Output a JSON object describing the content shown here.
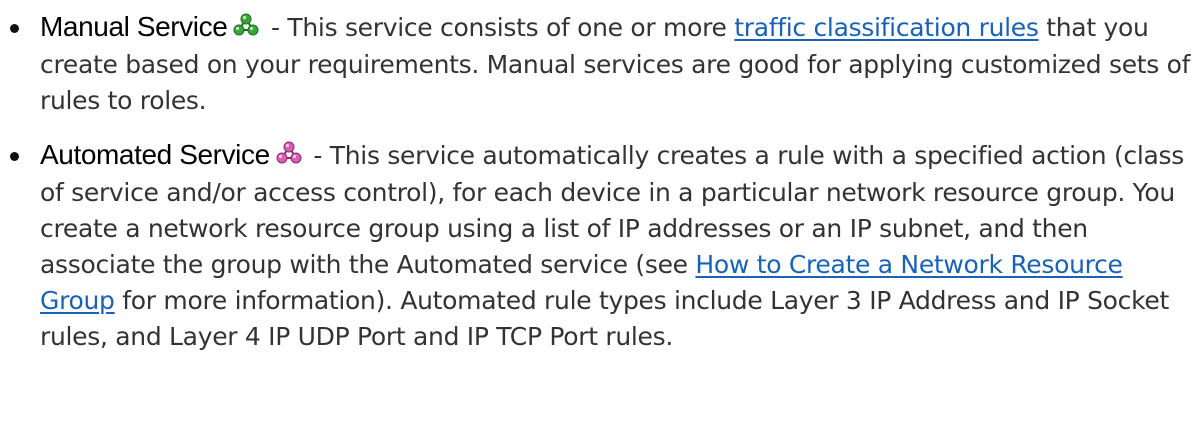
{
  "services": [
    {
      "term": "Manual Service",
      "icon": "manual-service-icon",
      "icon_color": "#2e8b2e",
      "text_before_link": " - This service consists of one or more ",
      "link_text": "traffic classification rules",
      "text_after_link": " that you create based on your requirements. Manual services are good for applying customized sets of rules to roles."
    },
    {
      "term": "Automated Service",
      "icon": "automated-service-icon",
      "icon_color": "#c040a0",
      "text_before_link": " - This service automatically creates a rule with a specified action (class of service and/or access control), for each device in a particular network resource group. You create a network resource group using a list of IP addresses or an IP subnet, and then associate the group with the Automated service (see ",
      "link_text": "How to Create a Network Resource Group",
      "text_after_link": " for more information). Automated rule types include Layer 3 IP Address and IP Socket rules, and Layer 4 IP UDP Port and IP TCP Port rules."
    }
  ],
  "colors": {
    "link": "#1a62b8",
    "text": "#333333",
    "term": "#000000"
  }
}
